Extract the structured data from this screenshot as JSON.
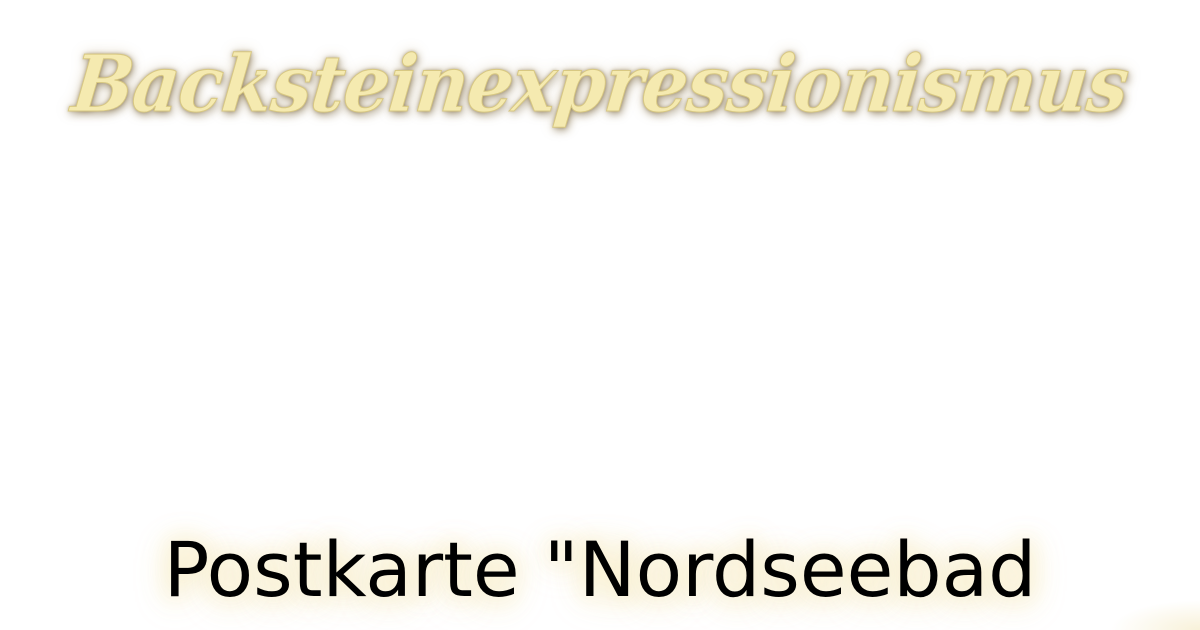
{
  "header": {
    "site_title": "Backsteinexpressionismus"
  },
  "main": {
    "postcard_caption": "Postkarte \"Nordseebad"
  },
  "colors": {
    "title_fill": "#f5eab0",
    "title_stroke": "#d8c882",
    "caption_text": "#000000",
    "caption_glow": "#faf0cd",
    "background": "#ffffff"
  }
}
